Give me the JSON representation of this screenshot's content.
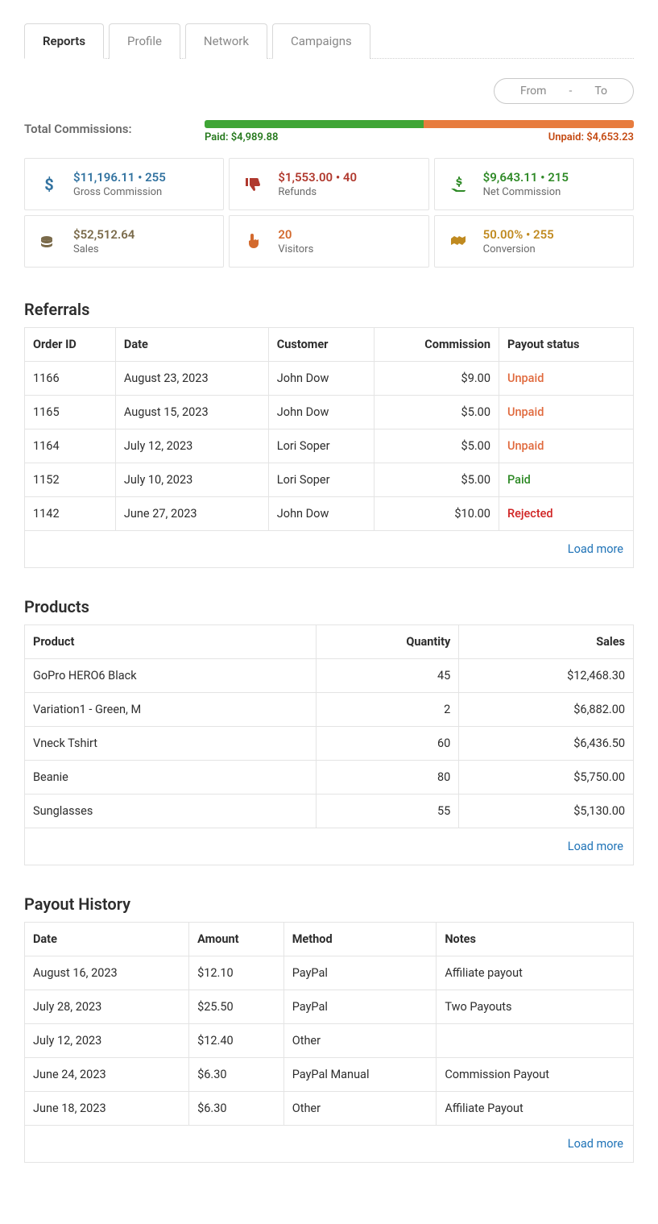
{
  "tabs": [
    {
      "label": "Reports",
      "active": true
    },
    {
      "label": "Profile",
      "active": false
    },
    {
      "label": "Network",
      "active": false
    },
    {
      "label": "Campaigns",
      "active": false
    }
  ],
  "date_range": {
    "from": "From",
    "sep": "-",
    "to": "To"
  },
  "totals": {
    "label": "Total Commissions:",
    "paid_label": "Paid: $4,989.88",
    "unpaid_label": "Unpaid: $4,653.23"
  },
  "stats": [
    {
      "icon": "dollar-icon",
      "color": "c-blue",
      "top": "$11,196.11 • 255",
      "sub": "Gross Commission"
    },
    {
      "icon": "thumbs-down-icon",
      "color": "c-red",
      "top": "$1,553.00 • 40",
      "sub": "Refunds"
    },
    {
      "icon": "hand-dollar-icon",
      "color": "c-green",
      "top": "$9,643.11 • 215",
      "sub": "Net Commission"
    },
    {
      "icon": "coins-icon",
      "color": "c-brown",
      "top": "$52,512.64",
      "sub": "Sales"
    },
    {
      "icon": "pointer-icon",
      "color": "c-orange",
      "top": "20",
      "sub": "Visitors"
    },
    {
      "icon": "handshake-icon",
      "color": "c-gold",
      "top": "50.00% • 255",
      "sub": "Conversion"
    }
  ],
  "referrals": {
    "title": "Referrals",
    "headers": [
      "Order ID",
      "Date",
      "Customer",
      "Commission",
      "Payout status"
    ],
    "rows": [
      {
        "id": "1166",
        "date": "August 23, 2023",
        "customer": "John Dow",
        "commission": "$9.00",
        "status": "Unpaid",
        "status_class": "status-unpaid"
      },
      {
        "id": "1165",
        "date": "August 15, 2023",
        "customer": "John Dow",
        "commission": "$5.00",
        "status": "Unpaid",
        "status_class": "status-unpaid"
      },
      {
        "id": "1164",
        "date": "July 12, 2023",
        "customer": "Lori Soper",
        "commission": "$5.00",
        "status": "Unpaid",
        "status_class": "status-unpaid"
      },
      {
        "id": "1152",
        "date": "July 10, 2023",
        "customer": "Lori Soper",
        "commission": "$5.00",
        "status": "Paid",
        "status_class": "status-paid"
      },
      {
        "id": "1142",
        "date": "June 27, 2023",
        "customer": "John Dow",
        "commission": "$10.00",
        "status": "Rejected",
        "status_class": "status-rejected"
      }
    ],
    "load_more": "Load more"
  },
  "products": {
    "title": "Products",
    "headers": [
      "Product",
      "Quantity",
      "Sales"
    ],
    "rows": [
      {
        "product": "GoPro HERO6 Black",
        "quantity": "45",
        "sales": "$12,468.30"
      },
      {
        "product": "Variation1 - Green, M",
        "quantity": "2",
        "sales": "$6,882.00"
      },
      {
        "product": "Vneck Tshirt",
        "quantity": "60",
        "sales": "$6,436.50"
      },
      {
        "product": "Beanie",
        "quantity": "80",
        "sales": "$5,750.00"
      },
      {
        "product": "Sunglasses",
        "quantity": "55",
        "sales": "$5,130.00"
      }
    ],
    "load_more": "Load more"
  },
  "payouts": {
    "title": "Payout History",
    "headers": [
      "Date",
      "Amount",
      "Method",
      "Notes"
    ],
    "rows": [
      {
        "date": "August 16, 2023",
        "amount": "$12.10",
        "method": "PayPal",
        "notes": "Affiliate payout"
      },
      {
        "date": "July 28, 2023",
        "amount": "$25.50",
        "method": "PayPal",
        "notes": "Two Payouts"
      },
      {
        "date": "July 12, 2023",
        "amount": "$12.40",
        "method": "Other",
        "notes": ""
      },
      {
        "date": "June 24, 2023",
        "amount": "$6.30",
        "method": "PayPal Manual",
        "notes": "Commission Payout"
      },
      {
        "date": "June 18, 2023",
        "amount": "$6.30",
        "method": "Other",
        "notes": "Affiliate Payout"
      }
    ],
    "load_more": "Load more"
  }
}
